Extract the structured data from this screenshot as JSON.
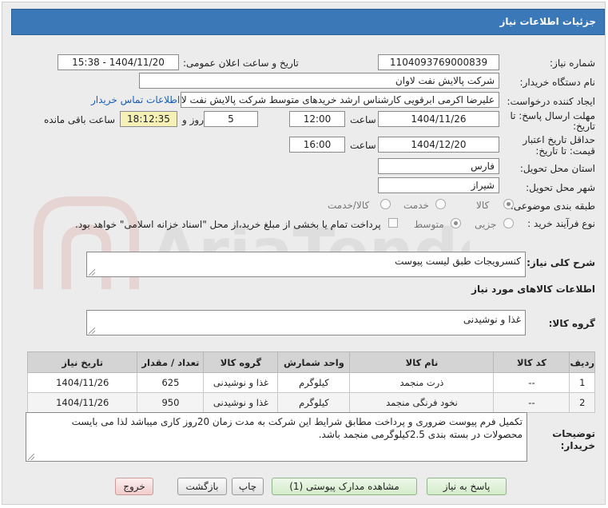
{
  "title": "جزئیات اطلاعات نیاز",
  "watermark": "AriaTender.net",
  "fields": {
    "need_number_label": "شماره نیاز:",
    "need_number": "1104093769000839",
    "announce_label": "تاریخ و ساعت اعلان عمومی:",
    "announce_value": "1404/11/20 - 15:38",
    "buyer_label": "نام دستگاه خریدار:",
    "buyer_value": "شرکت پالایش نفت لاوان",
    "creator_label": "ایجاد کننده درخواست:",
    "creator_value": "علیرضا اکرمی ابرقویی کارشناس ارشد خریدهای متوسط شرکت پالایش نفت لاوان",
    "contact_link": "اطلاعات تماس خریدار",
    "deadline_label": "مهلت ارسال پاسخ: تا",
    "deadline_label2": "تاریخ:",
    "deadline_date": "1404/11/26",
    "time_label": "ساعت",
    "deadline_time": "12:00",
    "days_value": "5",
    "days_label": "روز و",
    "remaining_time": "18:12:35",
    "remaining_label": "ساعت باقی مانده",
    "validity_label": "حداقل تاریخ اعتبار",
    "validity_label2": "قیمت: تا تاریخ:",
    "validity_date": "1404/12/20",
    "validity_time": "16:00",
    "province_label": "استان محل تحویل:",
    "province_value": "فارس",
    "city_label": "شهر محل تحویل:",
    "city_value": "شیراز",
    "category_label": "طبقه بندی موضوعی:",
    "category_options": [
      "کالا",
      "خدمت",
      "کالا/خدمت"
    ],
    "process_label": "نوع فرآیند خرید :",
    "process_options": [
      "جزیی",
      "متوسط"
    ],
    "payment_note": "پرداخت تمام یا بخشی از مبلغ خرید،از محل \"اسناد خزانه اسلامی\" خواهد بود."
  },
  "summary": {
    "label": "شرح کلی نیاز:",
    "value": "کنسرویجات طبق لیست پیوست"
  },
  "goods_info_title": "اطلاعات کالاهای مورد نیاز",
  "group": {
    "label": "گروه کالا:",
    "value": "غذا و نوشیدنی"
  },
  "table": {
    "headers": [
      "ردیف",
      "کد کالا",
      "نام کالا",
      "واحد شمارش",
      "گروه کالا",
      "تعداد / مقدار",
      "تاریخ نیاز"
    ],
    "rows": [
      [
        "1",
        "--",
        "ذرت منجمد",
        "کیلوگرم",
        "غذا و نوشیدنی",
        "625",
        "1404/11/26"
      ],
      [
        "2",
        "--",
        "نخود فرنگی منجمد",
        "کیلوگرم",
        "غذا و نوشیدنی",
        "950",
        "1404/11/26"
      ]
    ]
  },
  "buyer_notes": {
    "label": "توضیحات خریدار:",
    "value": "تکمیل فرم پیوست ضروری و پرداخت مطابق شرایط این شرکت به مدت زمان 20روز کاری میباشد لذا می بایست محصولات در بسته بندی 2.5کیلوگرمی منجمد باشد."
  },
  "buttons": {
    "reply": "پاسخ به نیاز",
    "docs": "مشاهده مدارک پیوستی (1)",
    "print": "چاپ",
    "back": "بازگشت",
    "exit": "خروج"
  }
}
